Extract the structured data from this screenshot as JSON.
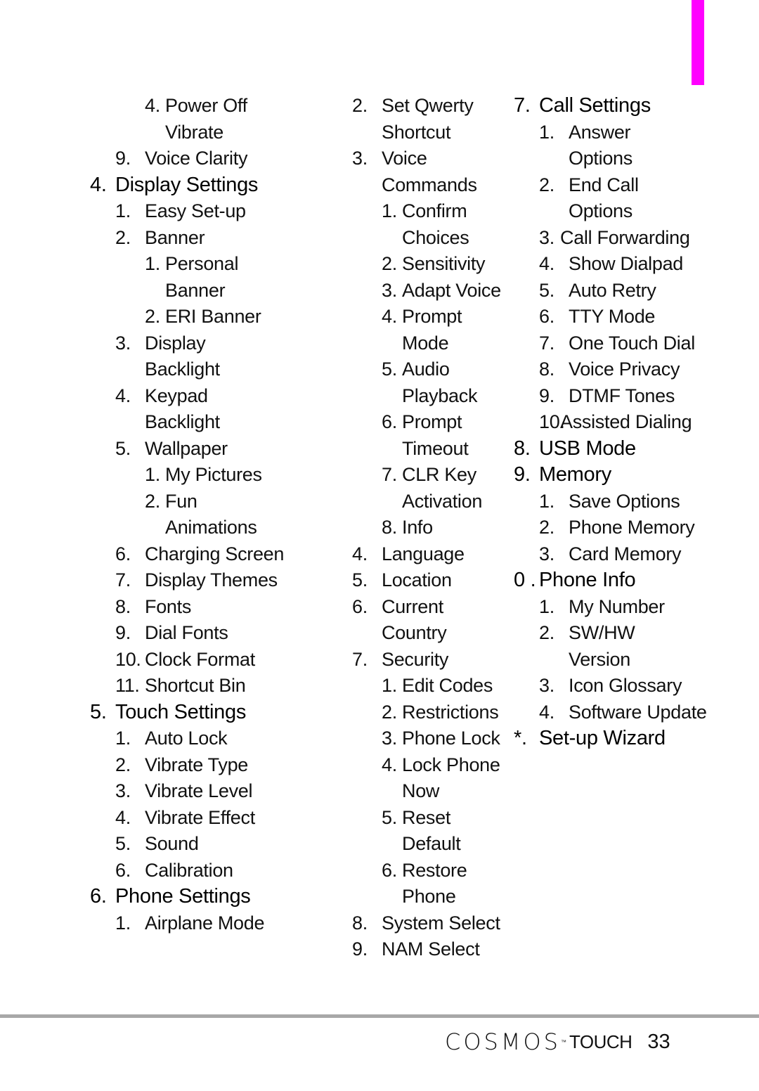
{
  "accent_color": "#ff00ff",
  "columns": [
    [
      {
        "lvl": 3,
        "num": "4.",
        "text": "Power Off"
      },
      {
        "lvl": 3,
        "num": "",
        "text": "Vibrate"
      },
      {
        "lvl": 2,
        "num": "9.",
        "text": "Voice Clarity"
      },
      {
        "lvl": 1,
        "num": "4.",
        "text": "Display Settings"
      },
      {
        "lvl": 2,
        "num": "1.",
        "text": "Easy Set-up"
      },
      {
        "lvl": 2,
        "num": "2.",
        "text": "Banner"
      },
      {
        "lvl": 3,
        "num": "1.",
        "text": "Personal"
      },
      {
        "lvl": 3,
        "num": "",
        "text": "Banner"
      },
      {
        "lvl": 3,
        "num": "2.",
        "text": "ERI Banner"
      },
      {
        "lvl": 2,
        "num": "3.",
        "text": "Display"
      },
      {
        "lvl": 2,
        "num": "",
        "text": "Backlight"
      },
      {
        "lvl": 2,
        "num": "4.",
        "text": "Keypad"
      },
      {
        "lvl": 2,
        "num": "",
        "text": "Backlight"
      },
      {
        "lvl": 2,
        "num": "5.",
        "text": "Wallpaper"
      },
      {
        "lvl": 3,
        "num": "1.",
        "text": "My Pictures"
      },
      {
        "lvl": 3,
        "num": "2.",
        "text": "Fun"
      },
      {
        "lvl": 3,
        "num": "",
        "text": "Animations"
      },
      {
        "lvl": 2,
        "num": "6.",
        "text": "Charging Screen"
      },
      {
        "lvl": 2,
        "num": "7.",
        "text": "Display Themes"
      },
      {
        "lvl": 2,
        "num": "8.",
        "text": "Fonts"
      },
      {
        "lvl": 2,
        "num": "9.",
        "text": "Dial Fonts"
      },
      {
        "lvl": 2,
        "num": "10.",
        "text": "Clock Format"
      },
      {
        "lvl": 2,
        "num": "11.",
        "text": "Shortcut Bin"
      },
      {
        "lvl": 1,
        "num": "5.",
        "text": "Touch Settings"
      },
      {
        "lvl": 2,
        "num": "1.",
        "text": "Auto Lock"
      },
      {
        "lvl": 2,
        "num": "2.",
        "text": "Vibrate Type"
      },
      {
        "lvl": 2,
        "num": "3.",
        "text": "Vibrate Level"
      },
      {
        "lvl": 2,
        "num": "4.",
        "text": "Vibrate Effect"
      },
      {
        "lvl": 2,
        "num": "5.",
        "text": "Sound"
      },
      {
        "lvl": 2,
        "num": "6.",
        "text": "Calibration"
      },
      {
        "lvl": 1,
        "num": "6.",
        "text": "Phone Settings"
      },
      {
        "lvl": 2,
        "num": "1.",
        "text": "Airplane Mode"
      }
    ],
    [
      {
        "lvl": 2,
        "num": "2.",
        "text": "Set Qwerty"
      },
      {
        "lvl": 2,
        "num": "",
        "text": "Shortcut"
      },
      {
        "lvl": 2,
        "num": "3.",
        "text": "Voice"
      },
      {
        "lvl": 2,
        "num": "",
        "text": "Commands"
      },
      {
        "lvl": 3,
        "num": "1.",
        "text": "Confirm"
      },
      {
        "lvl": 3,
        "num": "",
        "text": "Choices"
      },
      {
        "lvl": 3,
        "num": "2.",
        "text": "Sensitivity"
      },
      {
        "lvl": 3,
        "num": "3.",
        "text": "Adapt Voice"
      },
      {
        "lvl": 3,
        "num": "4.",
        "text": "Prompt"
      },
      {
        "lvl": 3,
        "num": "",
        "text": "Mode"
      },
      {
        "lvl": 3,
        "num": "5.",
        "text": "Audio"
      },
      {
        "lvl": 3,
        "num": "",
        "text": "Playback"
      },
      {
        "lvl": 3,
        "num": "6.",
        "text": "Prompt"
      },
      {
        "lvl": 3,
        "num": "",
        "text": "Timeout"
      },
      {
        "lvl": 3,
        "num": "7.",
        "text": "CLR Key"
      },
      {
        "lvl": 3,
        "num": "",
        "text": "Activation"
      },
      {
        "lvl": 3,
        "num": "8.",
        "text": "Info"
      },
      {
        "lvl": 2,
        "num": "4.",
        "text": "Language"
      },
      {
        "lvl": 2,
        "num": "5.",
        "text": "Location"
      },
      {
        "lvl": 2,
        "num": "6.",
        "text": "Current"
      },
      {
        "lvl": 2,
        "num": "",
        "text": "Country"
      },
      {
        "lvl": 2,
        "num": "7.",
        "text": "Security"
      },
      {
        "lvl": 3,
        "num": "1.",
        "text": "Edit Codes"
      },
      {
        "lvl": 3,
        "num": "2.",
        "text": "Restrictions"
      },
      {
        "lvl": 3,
        "num": "3.",
        "text": "Phone Lock"
      },
      {
        "lvl": 3,
        "num": "4.",
        "text": "Lock Phone"
      },
      {
        "lvl": 3,
        "num": "",
        "text": "Now"
      },
      {
        "lvl": 3,
        "num": "5.",
        "text": "Reset"
      },
      {
        "lvl": 3,
        "num": "",
        "text": "Default"
      },
      {
        "lvl": 3,
        "num": "6.",
        "text": "Restore"
      },
      {
        "lvl": 3,
        "num": "",
        "text": "Phone"
      },
      {
        "lvl": 2,
        "num": "8.",
        "text": "System Select"
      },
      {
        "lvl": 2,
        "num": "9.",
        "text": "NAM Select"
      }
    ],
    [
      {
        "lvl": 1,
        "num": "7.",
        "text": "Call Settings"
      },
      {
        "lvl": 2,
        "num": "1.",
        "text": "Answer"
      },
      {
        "lvl": 2,
        "num": "",
        "text": "Options"
      },
      {
        "lvl": 2,
        "num": "2.",
        "text": "End Call"
      },
      {
        "lvl": 2,
        "num": "",
        "text": "Options"
      },
      {
        "lvl": 2,
        "num": "3.",
        "text": "Call Forwarding",
        "tight": true
      },
      {
        "lvl": 2,
        "num": "4.",
        "text": "Show Dialpad"
      },
      {
        "lvl": 2,
        "num": "5.",
        "text": "Auto Retry"
      },
      {
        "lvl": 2,
        "num": "6.",
        "text": "TTY Mode"
      },
      {
        "lvl": 2,
        "num": "7.",
        "text": "One Touch Dial"
      },
      {
        "lvl": 2,
        "num": "8.",
        "text": "Voice Privacy"
      },
      {
        "lvl": 2,
        "num": "9.",
        "text": "DTMF Tones"
      },
      {
        "lvl": 2,
        "num": "10.",
        "text": "Assisted Dialing",
        "tight": true
      },
      {
        "lvl": 1,
        "num": "8.",
        "text": "USB Mode"
      },
      {
        "lvl": 1,
        "num": "9.",
        "text": "Memory"
      },
      {
        "lvl": 2,
        "num": "1.",
        "text": "Save Options"
      },
      {
        "lvl": 2,
        "num": "2.",
        "text": "Phone Memory"
      },
      {
        "lvl": 2,
        "num": "3.",
        "text": "Card Memory"
      },
      {
        "lvl": 1,
        "num": "0 .",
        "text": "Phone Info",
        "tight": true
      },
      {
        "lvl": 2,
        "num": "1.",
        "text": "My Number"
      },
      {
        "lvl": 2,
        "num": "2.",
        "text": "SW/HW"
      },
      {
        "lvl": 2,
        "num": "",
        "text": "Version"
      },
      {
        "lvl": 2,
        "num": "3.",
        "text": "Icon Glossary"
      },
      {
        "lvl": 2,
        "num": "4.",
        "text": "Software Update"
      },
      {
        "lvl": 1,
        "num": "*.",
        "text": "Set-up Wizard"
      }
    ]
  ],
  "footer": {
    "brand": "COSMOS",
    "trademark": "™",
    "product": "TOUCH",
    "page_number": "33"
  }
}
